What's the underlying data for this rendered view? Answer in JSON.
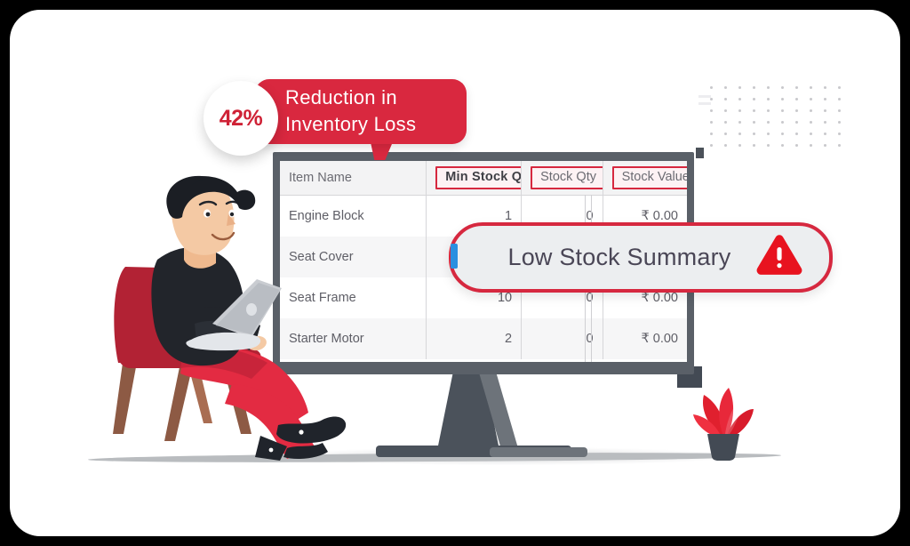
{
  "promo": {
    "badge_value": "42%",
    "line1": "Reduction  in",
    "line2": "Inventory Loss",
    "accent_color": "#d9283f",
    "badge_text_color": "#cf2236"
  },
  "summary": {
    "label": "Low Stock Summary",
    "warning_icon": "warning-triangle-icon",
    "border_color": "#d6283f",
    "background_color": "#eceef0",
    "text_color": "#4a4656"
  },
  "table": {
    "columns": [
      "Item Name",
      "Min Stock Qty",
      "Stock Qty",
      "Stock Value"
    ],
    "highlighted_columns": [
      "Min Stock Qty",
      "Stock Qty",
      "Stock Value"
    ],
    "rows": [
      {
        "item": "Engine Block",
        "min_stock_qty": "1",
        "stock_qty": "0",
        "stock_value": "₹ 0.00"
      },
      {
        "item": "Seat Cover",
        "min_stock_qty": "",
        "stock_qty": "",
        "stock_value": ""
      },
      {
        "item": "Seat Frame",
        "min_stock_qty": "10",
        "stock_qty": "0",
        "stock_value": "₹ 0.00"
      },
      {
        "item": "Starter Motor",
        "min_stock_qty": "2",
        "stock_qty": "0",
        "stock_value": "₹ 0.00"
      }
    ]
  },
  "illustration": {
    "person": "person-with-laptop-illustration",
    "chair": "armchair-illustration",
    "laptop": "laptop-illustration",
    "plant": "potted-plant-illustration",
    "monitor": "desktop-monitor-illustration",
    "dot_grid": "decorative-dot-grid",
    "colors": {
      "red": "#d9283f",
      "chair_red": "#b22234",
      "pants_red": "#e32b42",
      "shirt_dark": "#22252b",
      "skin": "#f4c9a4",
      "monitor_gray": "#5a6068",
      "plant_pot": "#434a54"
    }
  }
}
